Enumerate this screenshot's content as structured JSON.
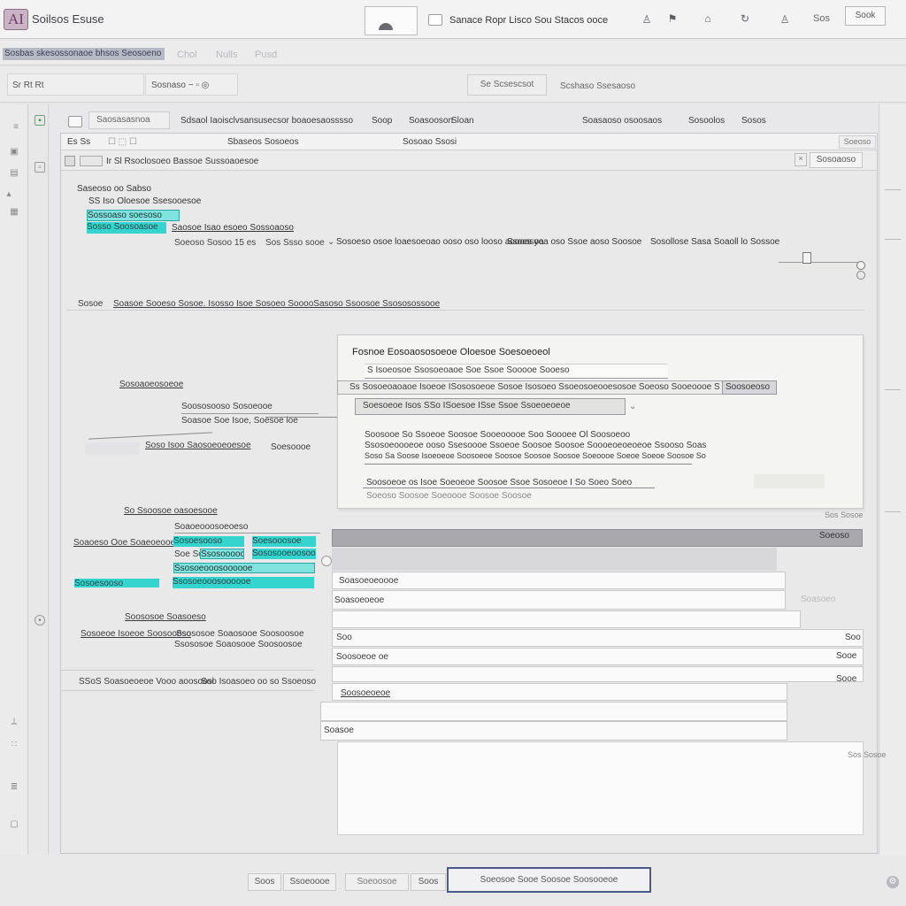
{
  "titlebar": {
    "logo": "AI",
    "app_title": "Soilsos Esuse",
    "doc_title": "Sanace Ropr Lisco Sou Stacos ooce",
    "extra_label": "Sos",
    "right_button": "Sook"
  },
  "ribbon": {
    "tabs": [
      "Sosbas skesossonaoe bhsos Seosoeno",
      "Chol",
      "Nulls",
      "Pusd"
    ]
  },
  "toolbar": {
    "field_1": "Sr Rt Rt",
    "field_2": "Sosnaso ~ ▫ ◎",
    "button": "Se Scsescsot",
    "right_text": "Scshaso Ssesaoso"
  },
  "main": {
    "header_field": "Saosasasnoa",
    "header_links": [
      "Sdsaol Iaoisclvsansusecsor boaoesaosssso",
      "Soop",
      "Soasooson",
      "Sloan",
      "Soasaoso osoosaos",
      "Sosoolos",
      "Sosos"
    ],
    "doc_tb1": [
      "Es Ss",
      "☐ ⬚ ☐",
      "Sbaseos Sosoeos",
      "Sosoao Ssosi"
    ],
    "doc_tb1_btn": "Soeoso",
    "doc_tb2": [
      "Ir Sl Rsoclosoeo Bassoe Sussoaoesoe"
    ],
    "doc_tb2_btn": "Sosoaoso"
  },
  "doc_top": {
    "line_1": "Saseoso oo Sabso",
    "line_2": "SS Iso Oloesoe Ssesooesoe",
    "hl_1": "Sossoaso soesoso",
    "hl_2": "Sosso Soosoasoe",
    "link_1": "Saosoe Isao esoeo Sossoaoso",
    "line_3": "Soeoso Sosoo 15 es",
    "line_4": "Sos Ssso sooe",
    "line_5": "Sosoeso osoe loaesoeoao ooso oso looso aoooasoa",
    "line_6": "Ssoes yoa oso Ssoe aoso Soosoe",
    "line_7": "Sosollose Sasa Soaoll lo Sossoe",
    "line_8": "Sosoe",
    "line_9": "Soasoe  Sooeso Sosoe. Isosso Isoe Sosoeo SooooSasoso Ssoosoe Ssososossooe"
  },
  "doc_left": {
    "label_1": "Sosoaoeosoeoe",
    "label_2": "Soososooso Sosoeooe",
    "label_3": "Soasoe Soe Isoe, Soesoe loe",
    "label_4": "Soso Isoo Saosoeoeoesoe",
    "label_5": "Soesoooe",
    "label_6": "So Ssoosoe oasoesooe",
    "label_7": "Soaoeooosoeoeso",
    "label_8": "Soaoeso Ooe  Soaeoeooe Soasoe",
    "cyan_1": "Sosoesooso",
    "cyan_2": "Soesooosoe",
    "cyan_3": "Soe Soeooso",
    "cyan_4": "Ssosooooosoooooe",
    "cyan_5": "Sososooeoosooeo",
    "cyan_6": "Ssosoeooosoooooe",
    "label_9": "Soososoe Soasoeso",
    "label_10": "Sosoeoe Isoeoe Soosoooso",
    "label_11": "Ssososoe Soaosooe Soosoosoe",
    "label_12": "SSoS Soasoeoeoe Vooo aoosoosl",
    "label_13": "Soo Isoasoeo oo so Ssoeoso",
    "label_14": "Soosoe"
  },
  "dialog": {
    "title": "Fosnoe Eosoaososoeoe Oloesoe Soesoeoeol",
    "row_1": "S Isoeosoe Ssosoeoaoe Soe Ssoe Sooooe Sooeso",
    "row_2": "Ss Sosoeoaoaoe Isoeoe ISososoeoe Sosoe Isosoeo Ssoeosoeooesosoe Soeoso Sooeoooe Soosoe",
    "row_2b": "Soosoeoso",
    "row_3": "Soesoeoe Isos SSo ISoesoe ISse Ssoe Ssoeoeoeoe",
    "row_4": "Soosooe So Ssoeoe Soosoe Sooeooooe Soo Soooee Ol Soosoeoooooooe",
    "row_5": "Ssosoeoooeoe ooso Ssesoooe Ssoeoe Soosoe Soosoe Soooeoeoeoeoe Ssooso Soasoe Soosoe ss Soosoe",
    "row_5b": "Soso Sa Soose  Isoeoeoe Soosoeoe Soosoe Soosoe Soosoe Soeoooe Soeoe  Soeoe Soosoe Soeoe",
    "row_6": "Soosoeoe os Isoe Soeoeoe Soosoe Ssoe Sosoeoe I So Soeo Soeosoe Soo",
    "row_7": "Soeoso Soosoe Soeoooe Soosoe Soosoe",
    "corner": "Sos Sosoe"
  },
  "grid": {
    "header_btn": "Soeoso",
    "rows": [
      "Soasoeoeoooe",
      "Soasoeoeoe",
      "Soo",
      "Soosoeoe oe",
      "Soosoeoeoe",
      "Soasoe"
    ],
    "right_bits": [
      "Soasoeo",
      "Soo",
      "Sooe",
      "Sooe"
    ]
  },
  "footer": {
    "field_1": "Soos",
    "field_2": "Ssoeoooe",
    "field_3": "Soeoosoe",
    "field_4": "Soos",
    "primary": "Soeosoe Sooe Soosoe Soosooeoe"
  },
  "colors": {
    "highlight": "#36d4cf",
    "primary_border": "#4a5b8b",
    "logo": "#c9b3c4"
  }
}
